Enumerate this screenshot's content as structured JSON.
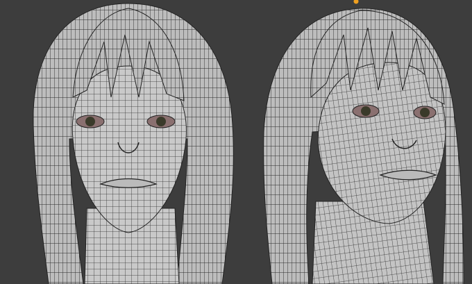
{
  "viewport": {
    "background_color": "#3d3d3d",
    "mesh_color": "#c9c9c9",
    "wire_color": "#2a2a2a",
    "origin_color": "#f0a020",
    "eye_color": "#3a3a2a"
  }
}
